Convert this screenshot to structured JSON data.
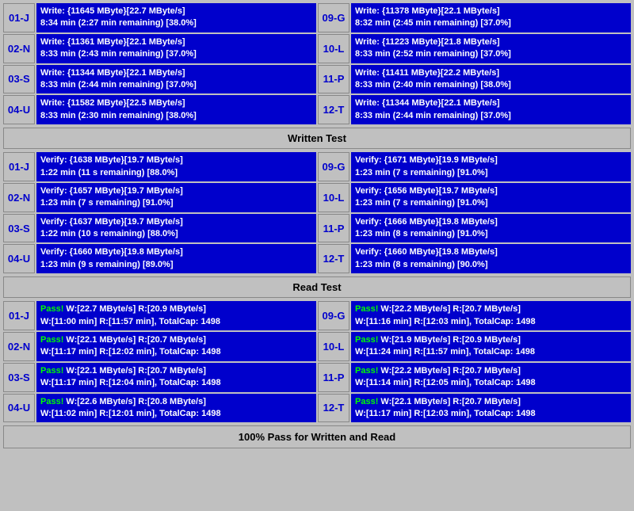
{
  "sections": {
    "written_test_label": "Written Test",
    "read_test_label": "Read Test",
    "status_label": "100% Pass for Written and Read"
  },
  "write_rows": [
    {
      "id_left": "01-J",
      "left_line1": "Write: {11645 MByte}[22.7 MByte/s]",
      "left_line2": "8:34 min (2:27 min remaining)  [38.0%]",
      "id_right": "09-G",
      "right_line1": "Write: {11378 MByte}[22.1 MByte/s]",
      "right_line2": "8:32 min (2:45 min remaining)  [37.0%]"
    },
    {
      "id_left": "02-N",
      "left_line1": "Write: {11361 MByte}[22.1 MByte/s]",
      "left_line2": "8:33 min (2:43 min remaining)  [37.0%]",
      "id_right": "10-L",
      "right_line1": "Write: {11223 MByte}[21.8 MByte/s]",
      "right_line2": "8:33 min (2:52 min remaining)  [37.0%]"
    },
    {
      "id_left": "03-S",
      "left_line1": "Write: {11344 MByte}[22.1 MByte/s]",
      "left_line2": "8:33 min (2:44 min remaining)  [37.0%]",
      "id_right": "11-P",
      "right_line1": "Write: {11411 MByte}[22.2 MByte/s]",
      "right_line2": "8:33 min (2:40 min remaining)  [38.0%]"
    },
    {
      "id_left": "04-U",
      "left_line1": "Write: {11582 MByte}[22.5 MByte/s]",
      "left_line2": "8:33 min (2:30 min remaining)  [38.0%]",
      "id_right": "12-T",
      "right_line1": "Write: {11344 MByte}[22.1 MByte/s]",
      "right_line2": "8:33 min (2:44 min remaining)  [37.0%]"
    }
  ],
  "verify_rows": [
    {
      "id_left": "01-J",
      "left_line1": "Verify: {1638 MByte}[19.7 MByte/s]",
      "left_line2": "1:22 min (11 s remaining)   [88.0%]",
      "id_right": "09-G",
      "right_line1": "Verify: {1671 MByte}[19.9 MByte/s]",
      "right_line2": "1:23 min (7 s remaining)   [91.0%]"
    },
    {
      "id_left": "02-N",
      "left_line1": "Verify: {1657 MByte}[19.7 MByte/s]",
      "left_line2": "1:23 min (7 s remaining)   [91.0%]",
      "id_right": "10-L",
      "right_line1": "Verify: {1656 MByte}[19.7 MByte/s]",
      "right_line2": "1:23 min (7 s remaining)   [91.0%]"
    },
    {
      "id_left": "03-S",
      "left_line1": "Verify: {1637 MByte}[19.7 MByte/s]",
      "left_line2": "1:22 min (10 s remaining)   [88.0%]",
      "id_right": "11-P",
      "right_line1": "Verify: {1666 MByte}[19.8 MByte/s]",
      "right_line2": "1:23 min (8 s remaining)   [91.0%]"
    },
    {
      "id_left": "04-U",
      "left_line1": "Verify: {1660 MByte}[19.8 MByte/s]",
      "left_line2": "1:23 min (9 s remaining)   [89.0%]",
      "id_right": "12-T",
      "right_line1": "Verify: {1660 MByte}[19.8 MByte/s]",
      "right_line2": "1:23 min (8 s remaining)   [90.0%]"
    }
  ],
  "pass_rows": [
    {
      "id_left": "01-J",
      "left_line1": "Pass! W:[22.7 MByte/s] R:[20.9 MByte/s]",
      "left_line2": "W:[11:00 min] R:[11:57 min], TotalCap: 1498",
      "id_right": "09-G",
      "right_line1": "Pass! W:[22.2 MByte/s] R:[20.7 MByte/s]",
      "right_line2": "W:[11:16 min] R:[12:03 min], TotalCap: 1498"
    },
    {
      "id_left": "02-N",
      "left_line1": "Pass! W:[22.1 MByte/s] R:[20.7 MByte/s]",
      "left_line2": "W:[11:17 min] R:[12:02 min], TotalCap: 1498",
      "id_right": "10-L",
      "right_line1": "Pass! W:[21.9 MByte/s] R:[20.9 MByte/s]",
      "right_line2": "W:[11:24 min] R:[11:57 min], TotalCap: 1498"
    },
    {
      "id_left": "03-S",
      "left_line1": "Pass! W:[22.1 MByte/s] R:[20.7 MByte/s]",
      "left_line2": "W:[11:17 min] R:[12:04 min], TotalCap: 1498",
      "id_right": "11-P",
      "right_line1": "Pass! W:[22.2 MByte/s] R:[20.7 MByte/s]",
      "right_line2": "W:[11:14 min] R:[12:05 min], TotalCap: 1498"
    },
    {
      "id_left": "04-U",
      "left_line1": "Pass! W:[22.6 MByte/s] R:[20.8 MByte/s]",
      "left_line2": "W:[11:02 min] R:[12:01 min], TotalCap: 1498",
      "id_right": "12-T",
      "right_line1": "Pass! W:[22.1 MByte/s] R:[20.7 MByte/s]",
      "right_line2": "W:[11:17 min] R:[12:03 min], TotalCap: 1498"
    }
  ]
}
